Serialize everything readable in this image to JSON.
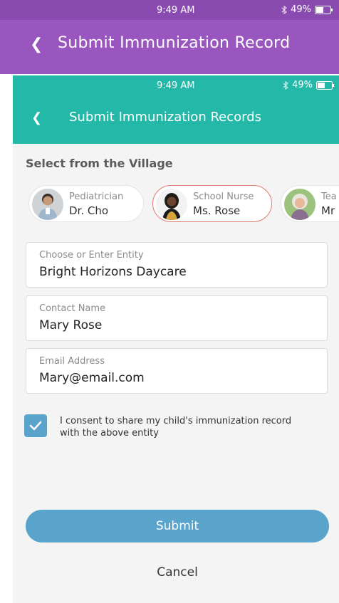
{
  "outer": {
    "status_time": "9:49 AM",
    "battery": "49%",
    "title": "Submit Immunization Record"
  },
  "inner": {
    "status_time": "9:49 AM",
    "battery": "49%",
    "title": "Submit Immunization Records"
  },
  "village": {
    "section_label": "Select from the Village",
    "contacts": [
      {
        "role": "Pediatrician",
        "name": "Dr. Cho"
      },
      {
        "role": "School Nurse",
        "name": "Ms. Rose"
      },
      {
        "role": "Tea",
        "name": "Mr"
      }
    ]
  },
  "form": {
    "entity": {
      "label": "Choose or Enter Entity",
      "value": "Bright Horizons Daycare"
    },
    "contact": {
      "label": "Contact Name",
      "value": "Mary Rose"
    },
    "email": {
      "label": "Email Address",
      "value": "Mary@email.com"
    },
    "consent": {
      "checked": true,
      "text": "I consent to share my child's immunization record with the above entity"
    }
  },
  "actions": {
    "submit": "Submit",
    "cancel": "Cancel"
  },
  "colors": {
    "outer_header": "#9856be",
    "inner_header": "#23b8a8",
    "accent": "#5aa4cc",
    "selected_border": "#e07a6c"
  }
}
